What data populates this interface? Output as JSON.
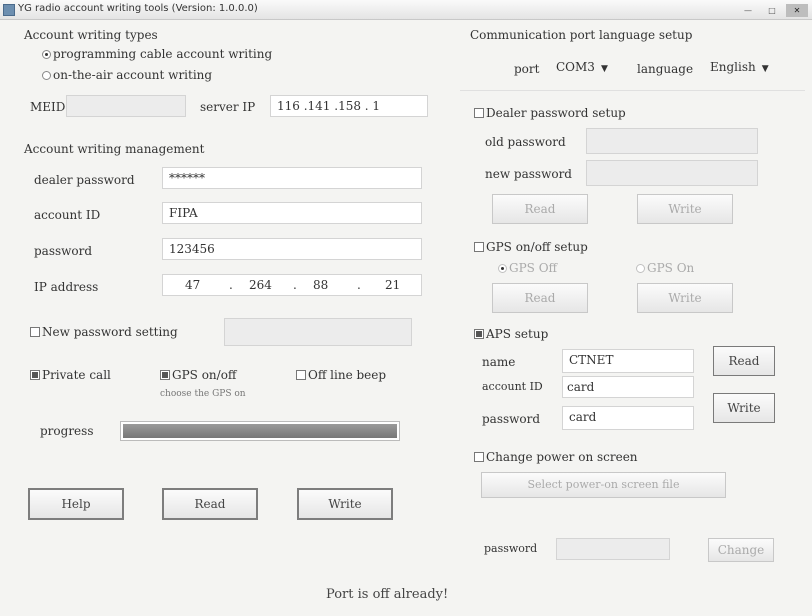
{
  "window": {
    "title": "YG radio account writing tools (Version: 1.0.0.0)",
    "controls": [
      "min",
      "max",
      "close"
    ]
  },
  "left": {
    "account_writing_types": {
      "header": "Account writing types",
      "options": [
        {
          "label": "programming cable account writing",
          "selected": true
        },
        {
          "label": "on-the-air account writing",
          "selected": false
        }
      ]
    },
    "meid_label": "MEID",
    "meid_value": "",
    "server_ip_label": "server IP",
    "server_ip_value": "116 .141 .158 . 1",
    "management": {
      "header": "Account writing management",
      "dealer_password_label": "dealer password",
      "dealer_password_value": "******",
      "account_id_label": "account ID",
      "account_id_value": "FIPA",
      "password_label": "password",
      "password_value": "123456",
      "ip_address_label": "IP address",
      "ip_octets": [
        "47",
        "264",
        "88",
        "21"
      ]
    },
    "new_password": {
      "label": "New password setting",
      "checked": false,
      "value": ""
    },
    "private_call": {
      "label": "Private call",
      "checked": true
    },
    "gps_onoff": {
      "label": "GPS on/off",
      "checked": true,
      "hint": "choose the GPS on"
    },
    "offline_beep": {
      "label": "Off line beep",
      "checked": false
    },
    "progress_label": "progress",
    "progress_value": 1.0,
    "buttons": {
      "help": "Help",
      "read": "Read",
      "write": "Write"
    }
  },
  "right": {
    "comm": {
      "header": "Communication port  language setup",
      "port_label": "port",
      "port_value": "COM3",
      "language_label": "language",
      "language_value": "English"
    },
    "dealer_pw_setup": {
      "label": "Dealer password setup",
      "checked": false,
      "old_label": "old password",
      "new_label": "new password",
      "read": "Read",
      "write": "Write"
    },
    "gps_setup": {
      "label": "GPS on/off setup",
      "checked": false,
      "opt_off": "GPS Off",
      "opt_on": "GPS On",
      "read": "Read",
      "write": "Write"
    },
    "aps_setup": {
      "label": "APS setup",
      "checked": true,
      "name_label": "name",
      "name_value": "CTNET",
      "account_label": "account ID",
      "account_value": "card",
      "password_label": "password",
      "password_value": "card",
      "read": "Read",
      "write": "Write"
    },
    "power_screen": {
      "label": "Change power on screen",
      "checked": false,
      "select_button": "Select power-on screen file"
    },
    "password_label": "password",
    "password_value": "",
    "change_button": "Change"
  },
  "status": "Port is off already!"
}
